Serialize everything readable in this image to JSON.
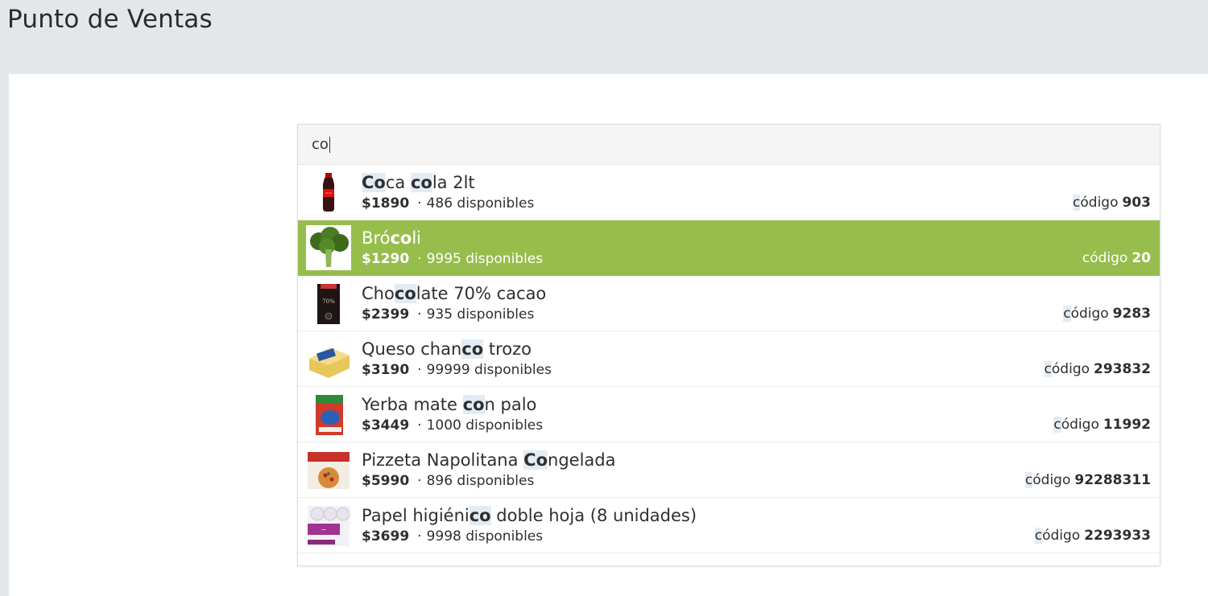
{
  "page": {
    "title": "Punto de Ventas"
  },
  "search": {
    "query": "co"
  },
  "labels": {
    "code_prefix": "código",
    "available_suffix": "disponibles"
  },
  "colors": {
    "selected_bg": "#97bd4d",
    "highlight_bg": "#e3ebf4"
  },
  "results": [
    {
      "name_parts": [
        {
          "t": "Co",
          "m": true
        },
        {
          "t": "ca ",
          "m": false
        },
        {
          "t": "co",
          "m": true
        },
        {
          "t": "la 2lt",
          "m": false
        }
      ],
      "price": "$1890",
      "stock": "486 disponibles",
      "code": "903",
      "image": "cola-bottle",
      "selected": false
    },
    {
      "name_parts": [
        {
          "t": "Bró",
          "m": false
        },
        {
          "t": "co",
          "m": true
        },
        {
          "t": "li",
          "m": false
        }
      ],
      "price": "$1290",
      "stock": "9995 disponibles",
      "code": "20",
      "image": "broccoli",
      "selected": true
    },
    {
      "name_parts": [
        {
          "t": "Cho",
          "m": false
        },
        {
          "t": "co",
          "m": true
        },
        {
          "t": "late 70% cacao",
          "m": false
        }
      ],
      "price": "$2399",
      "stock": "935 disponibles",
      "code": "9283",
      "image": "chocolate-bar",
      "selected": false
    },
    {
      "name_parts": [
        {
          "t": "Queso chan",
          "m": false
        },
        {
          "t": "co",
          "m": true
        },
        {
          "t": " trozo",
          "m": false
        }
      ],
      "price": "$3190",
      "stock": "99999 disponibles",
      "code": "293832",
      "image": "cheese-block",
      "selected": false
    },
    {
      "name_parts": [
        {
          "t": "Yerba mate ",
          "m": false
        },
        {
          "t": "co",
          "m": true
        },
        {
          "t": "n palo",
          "m": false
        }
      ],
      "price": "$3449",
      "stock": "1000 disponibles",
      "code": "11992",
      "image": "yerba-package",
      "selected": false
    },
    {
      "name_parts": [
        {
          "t": "Pizzeta Napolitana ",
          "m": false
        },
        {
          "t": "Co",
          "m": true
        },
        {
          "t": "ngelada",
          "m": false
        }
      ],
      "price": "$5990",
      "stock": "896 disponibles",
      "code": "92288311",
      "image": "pizza-box",
      "selected": false
    },
    {
      "name_parts": [
        {
          "t": "Papel higiéni",
          "m": false
        },
        {
          "t": "co",
          "m": true
        },
        {
          "t": " doble hoja (8 unidades)",
          "m": false
        }
      ],
      "price": "$3699",
      "stock": "9998 disponibles",
      "code": "2293933",
      "image": "toilet-paper-pack",
      "selected": false
    }
  ]
}
